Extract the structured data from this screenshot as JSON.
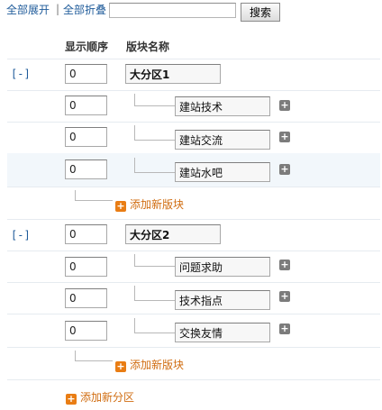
{
  "toolbar": {
    "expand_all": "全部展开",
    "separator": "|",
    "collapse_all": "全部折叠",
    "search_value": "",
    "search_button": "搜索"
  },
  "header": {
    "order_col": "显示顺序",
    "name_col": "版块名称"
  },
  "categories": [
    {
      "toggle": "[-]",
      "order": "0",
      "name": "大分区1",
      "forums": [
        {
          "order": "0",
          "name": "建站技术"
        },
        {
          "order": "0",
          "name": "建站交流"
        },
        {
          "order": "0",
          "name": "建站水吧"
        }
      ],
      "add_forum": "添加新版块"
    },
    {
      "toggle": "[-]",
      "order": "0",
      "name": "大分区2",
      "forums": [
        {
          "order": "0",
          "name": "问题求助"
        },
        {
          "order": "0",
          "name": "技术指点"
        },
        {
          "order": "0",
          "name": "交换友情"
        }
      ],
      "add_forum": "添加新版块"
    }
  ],
  "add_category": "添加新分区",
  "icons": {
    "add_subforum": "plus-gray-icon",
    "add_new": "plus-orange-icon"
  },
  "colors": {
    "link": "#1f5b9a",
    "add_link": "#d06c10",
    "add_icon": "#e97d14",
    "highlight_row": "#f2f7fb"
  }
}
